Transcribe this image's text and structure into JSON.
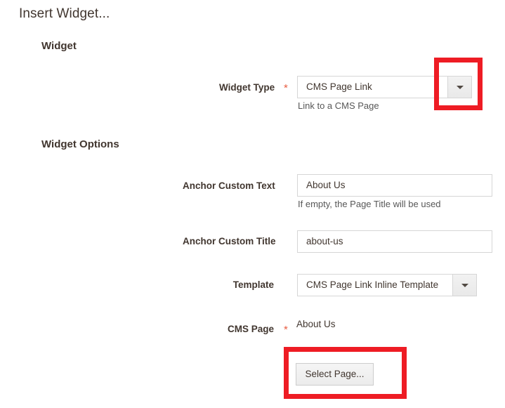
{
  "dialog": {
    "title": "Insert Widget..."
  },
  "sections": [
    {
      "id": "widget",
      "heading": "Widget"
    },
    {
      "id": "widget_options",
      "heading": "Widget Options"
    }
  ],
  "fields": {
    "widget_type": {
      "label": "Widget Type",
      "required_marker": "*",
      "value": "CMS Page Link",
      "note": "Link to a CMS Page",
      "caret_icon": "chevron-down-icon"
    },
    "anchor_custom_text": {
      "label": "Anchor Custom Text",
      "value": "About Us",
      "note": "If empty, the Page Title will be used"
    },
    "anchor_custom_title": {
      "label": "Anchor Custom Title",
      "value": "about-us"
    },
    "template": {
      "label": "Template",
      "value": "CMS Page Link Inline Template",
      "caret_icon": "chevron-down-icon"
    },
    "cms_page": {
      "label": "CMS Page",
      "required_marker": "*",
      "value": "About Us",
      "select_button_label": "Select Page..."
    }
  },
  "annotations": {
    "widget_type_dropdown_highlight": "red-rectangle",
    "select_page_button_highlight": "red-rectangle"
  },
  "colors": {
    "required_star": "#e85d42",
    "annotation": "#ee1c24",
    "text": "#41362f",
    "note_text": "#575757",
    "input_border": "#d6d6d6"
  }
}
